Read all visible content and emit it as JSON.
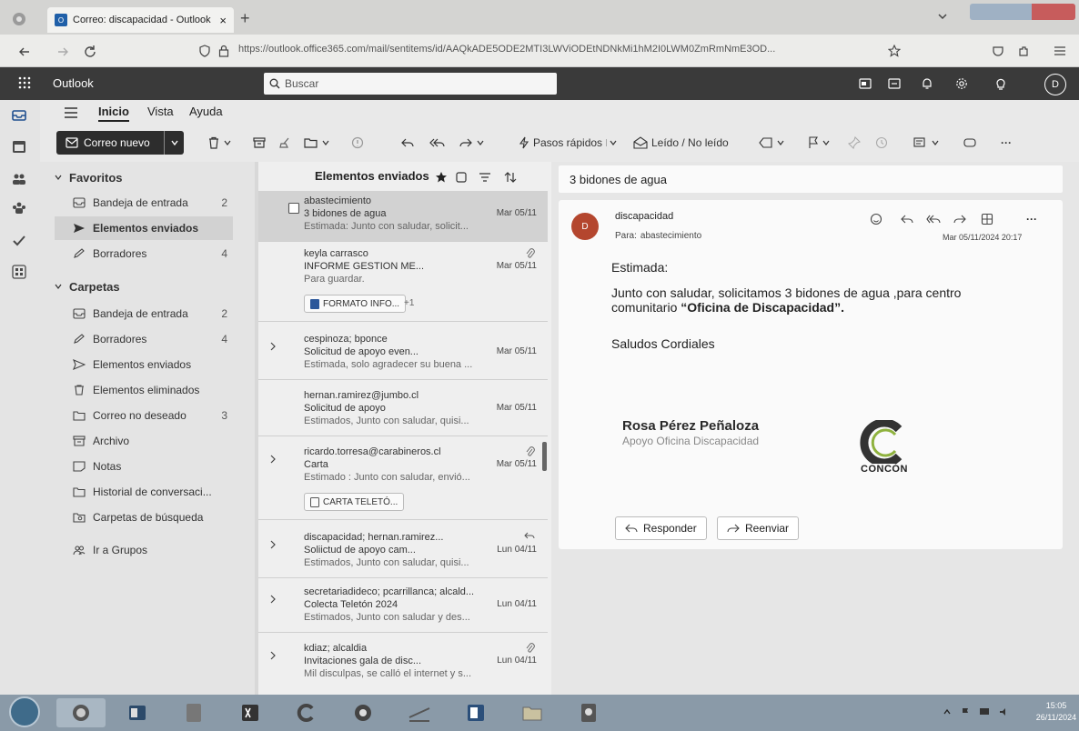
{
  "browser": {
    "tab_title": "Correo: discapacidad - Outlook",
    "tab_close": "×",
    "new_tab": "+",
    "url": "https://outlook.office365.com/mail/sentitems/id/AAQkADE5ODE2MTI3LWViODEtNDNkMi1hM2I0LWM0ZmRmNmE3OD..."
  },
  "outlook": {
    "app_name": "Outlook",
    "search_placeholder": "Buscar",
    "avatar_initial": "D"
  },
  "ribbon": {
    "tabs": [
      "Inicio",
      "Vista",
      "Ayuda"
    ],
    "new_mail_label": "Correo nuevo",
    "quick_steps": "Pasos rápidos",
    "read_unread": "Leído / No leído",
    "more": "···"
  },
  "folders": {
    "favorites_title": "Favoritos",
    "favorites": [
      {
        "label": "Bandeja de entrada",
        "count": "2"
      },
      {
        "label": "Elementos enviados",
        "count": ""
      },
      {
        "label": "Borradores",
        "count": "4"
      }
    ],
    "folders_title": "Carpetas",
    "items": [
      {
        "label": "Bandeja de entrada",
        "count": "2"
      },
      {
        "label": "Borradores",
        "count": "4"
      },
      {
        "label": "Elementos enviados",
        "count": ""
      },
      {
        "label": "Elementos eliminados",
        "count": ""
      },
      {
        "label": "Correo no deseado",
        "count": "3"
      },
      {
        "label": "Archivo",
        "count": ""
      },
      {
        "label": "Notas",
        "count": ""
      },
      {
        "label": "Historial de conversaci...",
        "count": ""
      },
      {
        "label": "Carpetas de búsqueda",
        "count": ""
      }
    ],
    "groups_link": "Ir a Grupos"
  },
  "message_list": {
    "title": "Elementos enviados",
    "messages": [
      {
        "from": "abastecimiento",
        "subject": "3 bidones de agua",
        "date": "Mar 05/11",
        "preview": "Estimada: Junto con saludar, solicit..."
      },
      {
        "from": "keyla carrasco",
        "subject": "INFORME GESTION ME...",
        "date": "Mar 05/11",
        "preview": "Para guardar.",
        "attachment": "FORMATO INFO...",
        "more": "+1"
      },
      {
        "from": "cespinoza; bponce",
        "subject": "Solicitud de apoyo even...",
        "date": "Mar 05/11",
        "preview": "Estimada, solo agradecer su buena ..."
      },
      {
        "from": "hernan.ramirez@jumbo.cl",
        "subject": "Solicitud de apoyo",
        "date": "Mar 05/11",
        "preview": "Estimados, Junto con saludar, quisi..."
      },
      {
        "from": "ricardo.torresa@carabineros.cl",
        "subject": "Carta",
        "date": "Mar 05/11",
        "preview": "Estimado : Junto con saludar, envió...",
        "attachment": "CARTA TELETÓ..."
      },
      {
        "from": "discapacidad; hernan.ramirez...",
        "subject": "Soliictud de apoyo cam...",
        "date": "Lun 04/11",
        "preview": "Estimados, Junto con saludar, quisi..."
      },
      {
        "from": "secretariadideco; pcarrillanca; alcald...",
        "subject": "Colecta Teletón 2024",
        "date": "Lun 04/11",
        "preview": "Estimados, Junto con saludar y des..."
      },
      {
        "from": "kdiaz; alcaldia",
        "subject": "Invitaciones gala de disc...",
        "date": "Lun 04/11",
        "preview": "Mil disculpas, se calló el internet y s..."
      }
    ]
  },
  "reading": {
    "subject": "3 bidones de agua",
    "sender": "discapacidad",
    "sender_initial": "D",
    "to_label": "Para:",
    "to": "abastecimiento",
    "datetime": "Mar 05/11/2024 20:17",
    "greeting": "Estimada:",
    "body_line1": "Junto con saludar, solicitamos 3 bidones de agua ,para centro",
    "body_line2_pre": "comunitario ",
    "body_line2_bold": "“Oficina de Discapacidad”.",
    "closing": "Saludos Cordiales",
    "signature_name": "Rosa Pérez Peñaloza",
    "signature_title": "Apoyo Oficina Discapacidad",
    "logo_text": "CONCÓN",
    "reply_label": "Responder",
    "forward_label": "Reenviar"
  },
  "taskbar": {
    "time": "15:05",
    "date": "26/11/2024"
  },
  "colors": {
    "outlook_header": "#3a3a3a",
    "selected_item": "#d2d2d2",
    "accent": "#0f6cbd"
  }
}
